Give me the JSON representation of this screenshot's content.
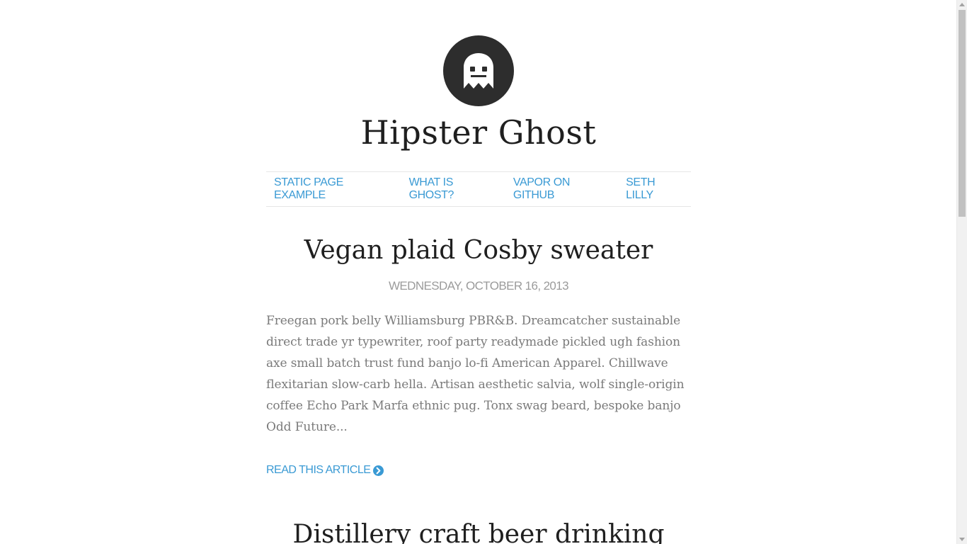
{
  "site": {
    "title": "Hipster Ghost",
    "logo_icon": "ghost-icon"
  },
  "nav": {
    "items": [
      {
        "label": "STATIC PAGE EXAMPLE"
      },
      {
        "label": "WHAT IS GHOST?"
      },
      {
        "label": "VAPOR ON GITHUB"
      },
      {
        "label": "SETH LILLY"
      }
    ]
  },
  "posts": [
    {
      "title": "Vegan plaid Cosby sweater",
      "date": "WEDNESDAY, OCTOBER 16, 2013",
      "excerpt": "Freegan pork belly Williamsburg PBR&B. Dreamcatcher sustainable direct trade yr typewriter, roof party readymade pickled ugh fashion axe small batch trust fund banjo lo-fi American Apparel. Chillwave flexitarian slow-carb hella. Artisan aesthetic salvia, wolf single-origin coffee Echo Park Marfa ethnic pug. Tonx swag beard, bespoke banjo Odd Future...",
      "read_more": "READ THIS ARTICLE",
      "read_more_icon": "chevron-circle-right-icon"
    },
    {
      "title": "Distillery craft beer drinking"
    }
  ],
  "colors": {
    "link": "#3a9ad4",
    "title": "#1f1f1f",
    "muted": "#9b9b9b",
    "body_text": "#7a7a7a",
    "logo_bg": "#2d2d2d"
  }
}
